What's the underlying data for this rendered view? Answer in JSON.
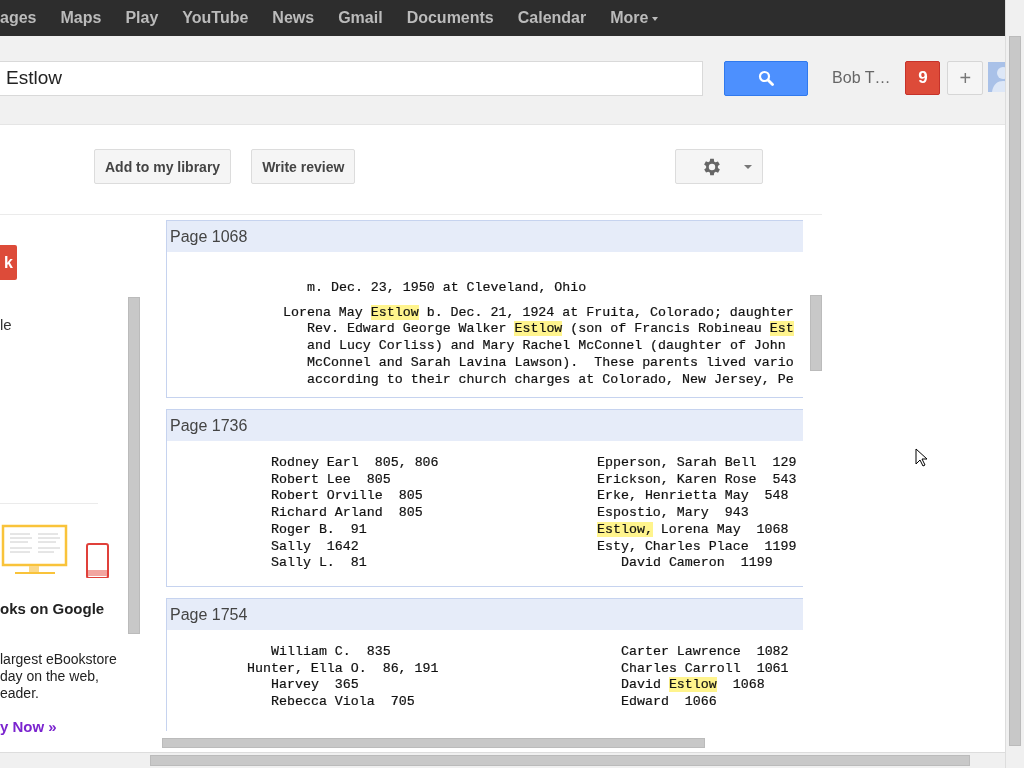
{
  "nav": {
    "items": [
      "ages",
      "Maps",
      "Play",
      "YouTube",
      "News",
      "Gmail",
      "Documents",
      "Calendar"
    ],
    "more": "More"
  },
  "search": {
    "value": "Estlow"
  },
  "account": {
    "name": "Bob T…",
    "notifications": "9",
    "share": "+"
  },
  "toolbar": {
    "buttons": [
      "Add to my library",
      "Write review"
    ]
  },
  "sidebar": {
    "button": "k",
    "text": "le",
    "promo_title": "oks on Google",
    "promo_body": "largest eBookstore\nday on the web,\neader.",
    "promo_link": "y Now »"
  },
  "results": [
    {
      "label": "Page 1068",
      "columns": [
        [
          {
            "kind": "sub",
            "parts": [
              {
                "text": "m. Dec. 23, 1950 at Cleveland, Ohio",
                "highlighted": false
              }
            ]
          },
          {
            "kind": "main",
            "parts": [
              {
                "text": "Lorena May ",
                "highlighted": false
              },
              {
                "text": "Estlow",
                "highlighted": true
              },
              {
                "text": " b. Dec. 21, 1924 at Fruita, Colorado; daughter",
                "highlighted": false
              }
            ]
          },
          {
            "kind": "sub",
            "parts": [
              {
                "text": "Rev. Edward George Walker ",
                "highlighted": false
              },
              {
                "text": "Estlow",
                "highlighted": true
              },
              {
                "text": " (son of Francis Robineau ",
                "highlighted": false
              },
              {
                "text": "Est",
                "highlighted": true
              }
            ]
          },
          {
            "kind": "sub",
            "parts": [
              {
                "text": "and Lucy Corliss) and Mary Rachel McConnel (daughter of John",
                "highlighted": false
              }
            ]
          },
          {
            "kind": "sub",
            "parts": [
              {
                "text": "McConnel and Sarah Lavina Lawson).  These parents lived vario",
                "highlighted": false
              }
            ]
          },
          {
            "kind": "sub",
            "parts": [
              {
                "text": "according to their church charges at Colorado, New Jersey, Pe",
                "highlighted": false
              }
            ]
          }
        ]
      ]
    },
    {
      "label": "Page 1736",
      "columns": [
        [
          {
            "kind": "sub",
            "parts": [
              {
                "text": "Rodney Earl  805, 806",
                "highlighted": false
              }
            ]
          },
          {
            "kind": "sub",
            "parts": [
              {
                "text": "Robert Lee  805",
                "highlighted": false
              }
            ]
          },
          {
            "kind": "sub",
            "parts": [
              {
                "text": "Robert Orville  805",
                "highlighted": false
              }
            ]
          },
          {
            "kind": "sub",
            "parts": [
              {
                "text": "Richard Arland  805",
                "highlighted": false
              }
            ]
          },
          {
            "kind": "sub",
            "parts": [
              {
                "text": "Roger B.  91",
                "highlighted": false
              }
            ]
          },
          {
            "kind": "sub",
            "parts": [
              {
                "text": "Sally  1642",
                "highlighted": false
              }
            ]
          },
          {
            "kind": "sub",
            "parts": [
              {
                "text": "Sally L.  81",
                "highlighted": false
              }
            ]
          }
        ],
        [
          {
            "kind": "main",
            "parts": [
              {
                "text": "Epperson, Sarah Bell  129",
                "highlighted": false
              }
            ]
          },
          {
            "kind": "main",
            "parts": [
              {
                "text": "Erickson, Karen Rose  543",
                "highlighted": false
              }
            ]
          },
          {
            "kind": "main",
            "parts": [
              {
                "text": "Erke, Henrietta May  548",
                "highlighted": false
              }
            ]
          },
          {
            "kind": "main",
            "parts": [
              {
                "text": "Espostio, Mary  943",
                "highlighted": false
              }
            ]
          },
          {
            "kind": "main",
            "parts": [
              {
                "text": "Estlow,",
                "highlighted": true
              },
              {
                "text": " Lorena May  1068",
                "highlighted": false
              }
            ]
          },
          {
            "kind": "main",
            "parts": [
              {
                "text": "Esty, Charles Place  1199",
                "highlighted": false
              }
            ]
          },
          {
            "kind": "sub",
            "parts": [
              {
                "text": "David Cameron  1199",
                "highlighted": false
              }
            ]
          }
        ]
      ]
    },
    {
      "label": "Page 1754",
      "columns": [
        [
          {
            "kind": "sub",
            "parts": [
              {
                "text": "William C.  835",
                "highlighted": false
              }
            ]
          },
          {
            "kind": "main",
            "parts": [
              {
                "text": "Hunter, Ella O.  86, 191",
                "highlighted": false
              }
            ]
          },
          {
            "kind": "sub",
            "parts": [
              {
                "text": "Harvey  365",
                "highlighted": false
              }
            ]
          },
          {
            "kind": "sub",
            "parts": [
              {
                "text": "Rebecca Viola  705",
                "highlighted": false
              }
            ]
          }
        ],
        [
          {
            "kind": "sub",
            "parts": [
              {
                "text": "Carter Lawrence  1082",
                "highlighted": false
              }
            ]
          },
          {
            "kind": "sub",
            "parts": [
              {
                "text": "Charles Carroll  1061",
                "highlighted": false
              }
            ]
          },
          {
            "kind": "sub",
            "parts": [
              {
                "text": "David ",
                "highlighted": false
              },
              {
                "text": "Estlow",
                "highlighted": true
              },
              {
                "text": "  1068",
                "highlighted": false
              }
            ]
          },
          {
            "kind": "sub",
            "parts": [
              {
                "text": "Edward  1066",
                "highlighted": false
              }
            ]
          }
        ]
      ]
    }
  ]
}
